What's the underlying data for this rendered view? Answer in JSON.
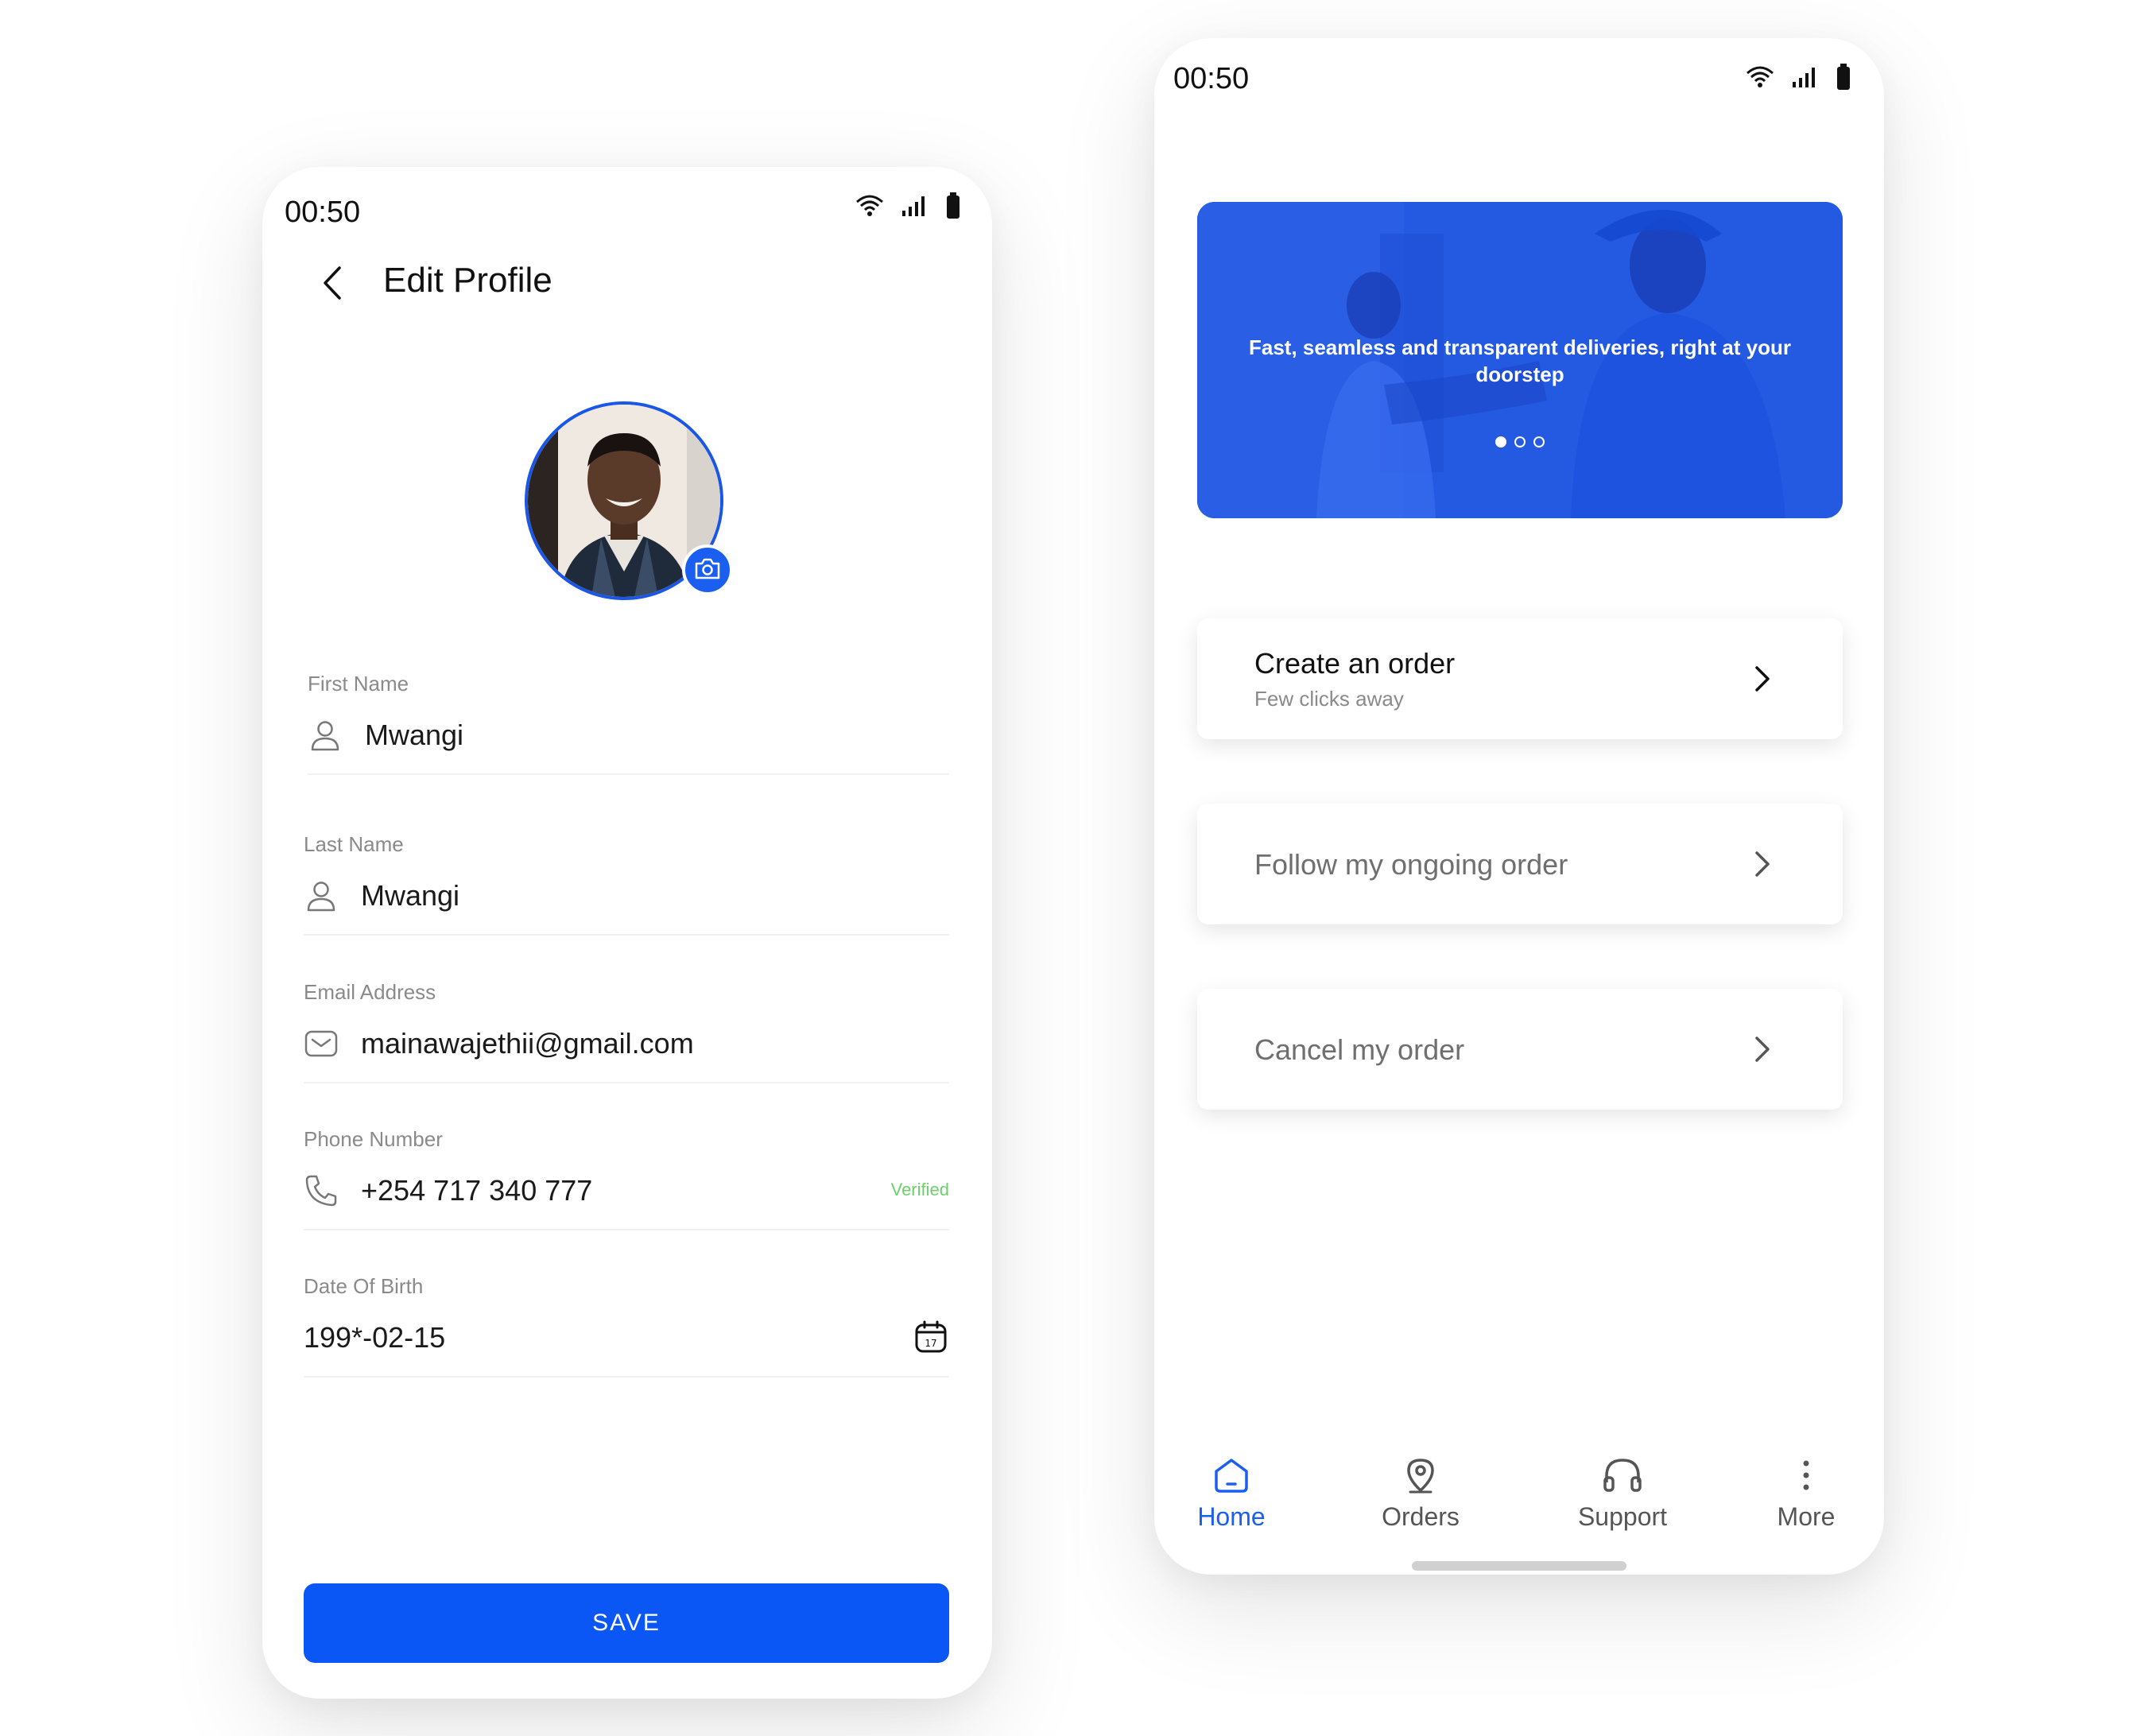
{
  "edit_profile_screen": {
    "status_bar": {
      "time": "00:50"
    },
    "header": {
      "title": "Edit Profile"
    },
    "fields": {
      "first_name": {
        "label": "First Name",
        "value": "Mwangi"
      },
      "last_name": {
        "label": "Last Name",
        "value": "Mwangi"
      },
      "email": {
        "label": "Email Address",
        "value": "mainawajethii@gmail.com"
      },
      "phone": {
        "label": "Phone Number",
        "value": "+254 717 340 777",
        "badge": "Verified"
      },
      "dob": {
        "label": "Date Of Birth",
        "value": "199*-02-15"
      }
    },
    "save_label": "SAVE"
  },
  "home_screen": {
    "status_bar": {
      "time": "00:50"
    },
    "banner": {
      "text": "Fast, seamless and transparent deliveries, right at your doorstep",
      "slide_count": 3,
      "active_slide": 1
    },
    "actions": {
      "create": {
        "title": "Create an order",
        "subtitle": "Few clicks away"
      },
      "follow": {
        "title": "Follow my ongoing order"
      },
      "cancel": {
        "title": "Cancel my order"
      }
    },
    "nav": {
      "home": "Home",
      "orders": "Orders",
      "support": "Support",
      "more": "More",
      "active": "Home"
    }
  },
  "colors": {
    "primary": "#0b57f5",
    "banner_blue": "#2459e2",
    "verified_green": "#6ccf6c",
    "label_gray": "#8a8a8a"
  },
  "icons": {
    "back": "chevron-left-icon",
    "camera": "camera-icon",
    "person": "person-icon",
    "mail": "mail-icon",
    "phone": "phone-icon",
    "calendar": "calendar-icon",
    "chevron": "chevron-right-icon",
    "home": "home-icon",
    "orders": "location-pin-icon",
    "support": "headset-icon",
    "more": "more-vertical-icon"
  }
}
